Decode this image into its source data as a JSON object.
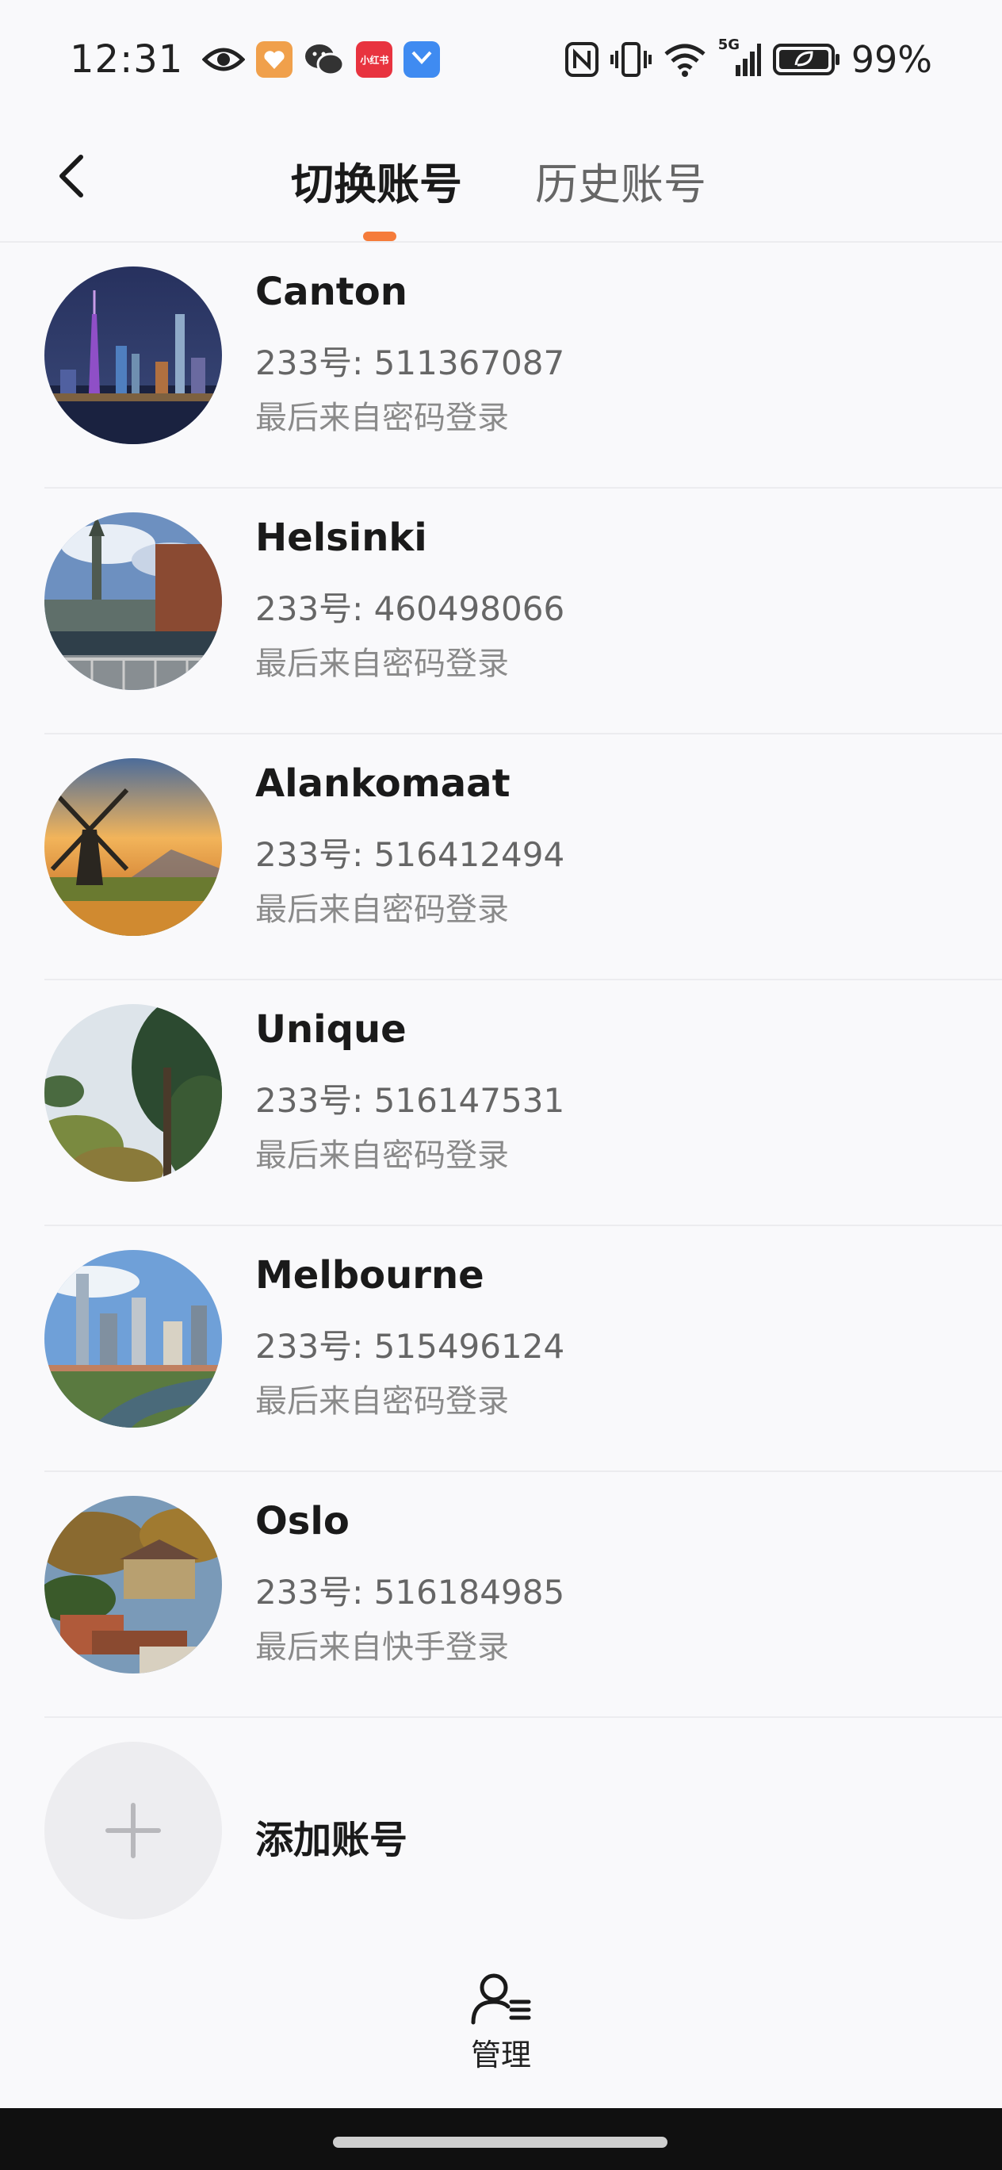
{
  "status_bar": {
    "time": "12:31",
    "network": "5G",
    "battery": "99%",
    "icons": [
      "eye-icon",
      "app-heart-icon",
      "wechat-icon",
      "xiaohongshu-icon",
      "honor-app-icon",
      "nfc-icon",
      "vibrate-icon",
      "wifi-icon",
      "signal-icon",
      "battery-icon"
    ],
    "xiaohongshu_label": "小红书"
  },
  "header": {
    "tabs": [
      {
        "label": "切换账号",
        "active": true
      },
      {
        "label": "历史账号",
        "active": false
      }
    ],
    "accent_color": "#f57c3a"
  },
  "accounts": [
    {
      "name": "Canton",
      "id": "233号: 511367087",
      "login": "最后来自密码登录",
      "avatar": "canton-skyline"
    },
    {
      "name": "Helsinki",
      "id": "233号: 460498066",
      "login": "最后来自密码登录",
      "avatar": "helsinki-canal"
    },
    {
      "name": "Alankomaat",
      "id": "233号: 516412494",
      "login": "最后来自密码登录",
      "avatar": "windmill-sunset"
    },
    {
      "name": "Unique",
      "id": "233号: 516147531",
      "login": "最后来自密码登录",
      "avatar": "pine-forest"
    },
    {
      "name": "Melbourne",
      "id": "233号: 515496124",
      "login": "最后来自密码登录",
      "avatar": "melbourne-river"
    },
    {
      "name": "Oslo",
      "id": "233号: 516184985",
      "login": "最后来自快手登录",
      "avatar": "oslo-town"
    }
  ],
  "add_account": {
    "label": "添加账号"
  },
  "manage": {
    "label": "管理"
  }
}
